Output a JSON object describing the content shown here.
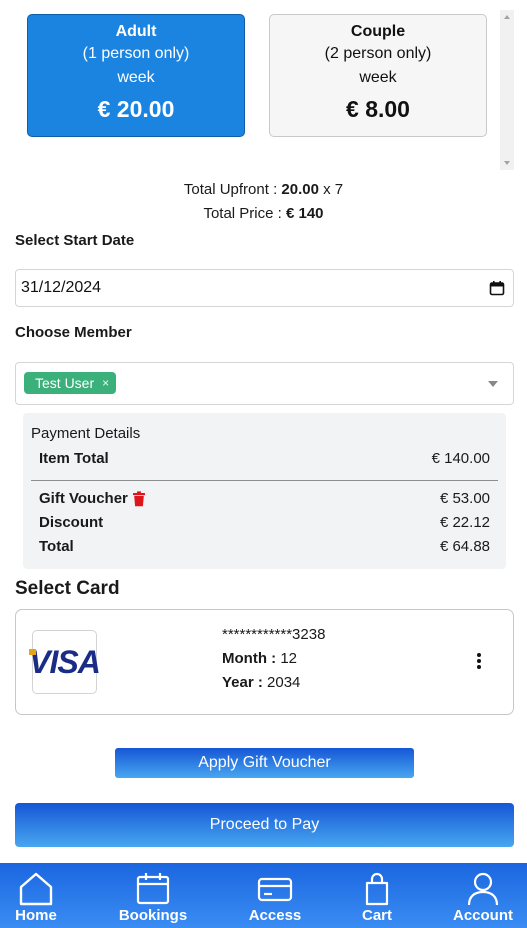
{
  "plans": [
    {
      "name": "Adult",
      "subtitle": "(1 person only)",
      "period": "week",
      "price": "€ 20.00",
      "selected": true
    },
    {
      "name": "Couple",
      "subtitle": "(2 person only)",
      "period": "week",
      "price": "€ 8.00",
      "selected": false
    }
  ],
  "summary": {
    "upfront_label": "Total Upfront : ",
    "upfront_amount": "20.00",
    "upfront_multiplier": " x 7",
    "price_label": "Total Price : ",
    "price_amount": "€ 140"
  },
  "start_date": {
    "label": "Select Start Date",
    "value": "31/12/2024"
  },
  "member": {
    "label": "Choose Member",
    "selected": "Test User",
    "remove_symbol": "×"
  },
  "payment_details": {
    "title": "Payment Details",
    "item_total_label": "Item Total",
    "item_total_value": "€ 140.00",
    "gift_voucher_label": "Gift Voucher",
    "gift_voucher_value": "€ 53.00",
    "discount_label": "Discount",
    "discount_value": "€ 22.12",
    "total_label": "Total",
    "total_value": "€ 64.88"
  },
  "card_section": {
    "title": "Select Card",
    "brand": "VISA",
    "number": "************3238",
    "month_label": "Month : ",
    "month_value": "12",
    "year_label": "Year : ",
    "year_value": "2034"
  },
  "actions": {
    "gift_voucher": "Apply Gift Voucher",
    "proceed": "Proceed to Pay"
  },
  "nav": [
    {
      "label": "Home",
      "icon": "home-icon"
    },
    {
      "label": "Bookings",
      "icon": "calendar-icon"
    },
    {
      "label": "Access",
      "icon": "card-icon"
    },
    {
      "label": "Cart",
      "icon": "bag-icon"
    },
    {
      "label": "Account",
      "icon": "user-icon"
    }
  ],
  "colors": {
    "primary": "#1a84e0",
    "nav_gradient_top": "#1b66e0",
    "nav_gradient_bottom": "#3a8df3",
    "chip_green": "#3bb07a",
    "danger": "#e0151a"
  }
}
